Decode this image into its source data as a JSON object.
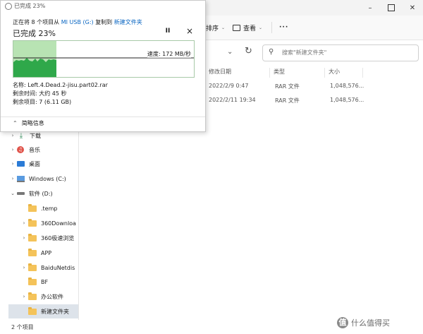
{
  "explorer": {
    "toolbar": {
      "sort_label": "排序",
      "view_label": "查看",
      "more_label": "···"
    },
    "search": {
      "placeholder": "搜索\"新建文件夹\""
    },
    "columns": {
      "modified": "修改日期",
      "type": "类型",
      "size": "大小"
    },
    "files": [
      {
        "modified": "2022/2/9 0:47",
        "type": "RAR 文件",
        "size": "1,048,576..."
      },
      {
        "modified": "2022/2/11 19:34",
        "type": "RAR 文件",
        "size": "1,048,576..."
      }
    ],
    "sidebar": {
      "items": [
        {
          "label": "下载"
        },
        {
          "label": "音乐"
        },
        {
          "label": "桌面"
        },
        {
          "label": "Windows (C:)"
        },
        {
          "label": "软件 (D:)"
        },
        {
          "label": ".temp"
        },
        {
          "label": "360Downloa"
        },
        {
          "label": "360极速浏览"
        },
        {
          "label": "APP"
        },
        {
          "label": "BaiduNetdis"
        },
        {
          "label": "BF"
        },
        {
          "label": "办公软件"
        },
        {
          "label": "新建文件夹"
        }
      ]
    },
    "status": {
      "item_count": "2 个项目"
    }
  },
  "copy_dialog": {
    "title": "已完成 23%",
    "description_prefix": "正在将 8 个项目从",
    "source": "MI USB (G:)",
    "copy_to": "复制到",
    "destination": "新建文件夹",
    "progress_text": "已完成 23%",
    "progress": 0.23,
    "speed_text": "速度: 172 MB/秒",
    "name_label": "名称:",
    "name_value": "Left.4.Dead.2-jisu.part02.rar",
    "time_label": "剩余时间:",
    "time_value": "大约 45 秒",
    "items_label": "剩余项目:",
    "items_value": "7 (6.11 GB)",
    "details_toggle": "简略信息",
    "pause_symbol": "II",
    "close_symbol": "×"
  },
  "watermark": {
    "text": "什么值得买"
  },
  "colors": {
    "graph_fill": "#2fa84a",
    "graph_bg": "#b8e3b3",
    "accent": "#0a66c2"
  }
}
